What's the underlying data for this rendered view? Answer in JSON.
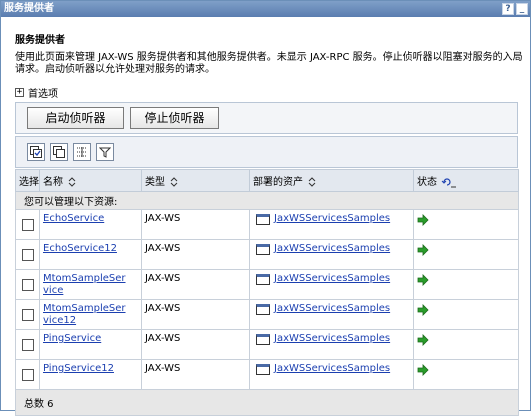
{
  "window": {
    "title": "服务提供者",
    "help_button": "?",
    "min_button": "_"
  },
  "section_title": "服务提供者",
  "description": "使用此页面来管理 JAX-WS 服务提供者和其他服务提供者。未显示 JAX-RPC 服务。停止侦听器以阻塞对服务的入局请求。启动侦听器以允许处理对服务的请求。",
  "preferences": {
    "toggle": "+",
    "label": "首选项"
  },
  "buttons": {
    "start": "启动侦听器",
    "stop": "停止侦听器"
  },
  "toolbar_icons": [
    "select-all-icon",
    "deselect-all-icon",
    "show-filter-icon",
    "clear-filter-icon"
  ],
  "table": {
    "columns": {
      "select": "选择",
      "name": "名称",
      "type": "类型",
      "asset": "部署的资产",
      "status": "状态"
    },
    "info_row": "您可以管理以下资源:",
    "rows": [
      {
        "name": "EchoService",
        "type": "JAX-WS",
        "asset": "JaxWSServicesSamples",
        "status_icon": "started-arrow-icon"
      },
      {
        "name": "EchoService12",
        "type": "JAX-WS",
        "asset": "JaxWSServicesSamples",
        "status_icon": "started-arrow-icon"
      },
      {
        "name": "MtomSampleService",
        "name_line1": "MtomSampleSer",
        "name_line2": "vice",
        "type": "JAX-WS",
        "asset": "JaxWSServicesSamples",
        "status_icon": "started-arrow-icon"
      },
      {
        "name": "MtomSampleService12",
        "name_line1": "MtomSampleSer",
        "name_line2": "vice12",
        "type": "JAX-WS",
        "asset": "JaxWSServicesSamples",
        "status_icon": "started-arrow-icon"
      },
      {
        "name": "PingService",
        "type": "JAX-WS",
        "asset": "JaxWSServicesSamples",
        "status_icon": "started-arrow-icon"
      },
      {
        "name": "PingService12",
        "type": "JAX-WS",
        "asset": "JaxWSServicesSamples",
        "status_icon": "started-arrow-icon"
      }
    ],
    "total_label": "总数 6"
  },
  "colors": {
    "titlebar": "#5a7db0",
    "link": "#1b3fb0",
    "status_green": "#2a9d2a"
  }
}
